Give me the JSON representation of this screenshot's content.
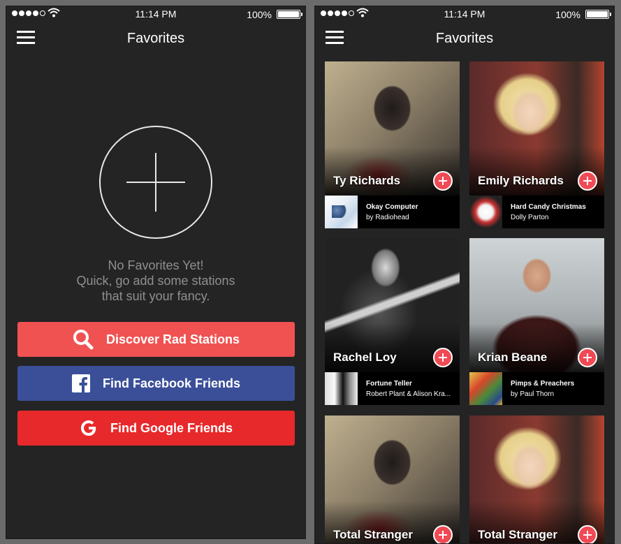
{
  "status_bar": {
    "time": "11:14 PM",
    "battery": "100%"
  },
  "left": {
    "title": "Favorites",
    "empty": {
      "line1": "No Favorites Yet!",
      "line2": "Quick, go add some stations",
      "line3": "that suit your fancy."
    },
    "buttons": {
      "discover": "Discover Rad Stations",
      "facebook": "Find Facebook Friends",
      "google": "Find Google Friends"
    },
    "colors": {
      "discover": "#f05252",
      "facebook": "#3b4f99",
      "google": "#e8292b"
    }
  },
  "right": {
    "title": "Favorites",
    "cards": [
      {
        "name": "Ty Richards",
        "track": "Okay Computer",
        "artist": "by Radiohead"
      },
      {
        "name": "Emily Richards",
        "track": "Hard Candy Christmas",
        "artist": "Dolly Parton"
      },
      {
        "name": "Rachel Loy",
        "track": "Fortune Teller",
        "artist": "Robert Plant & Alison Kra..."
      },
      {
        "name": "Krian Beane",
        "track": "Pimps & Preachers",
        "artist": "by Paul Thorn"
      },
      {
        "name": "Total Stranger"
      },
      {
        "name": "Total Stranger"
      }
    ]
  }
}
